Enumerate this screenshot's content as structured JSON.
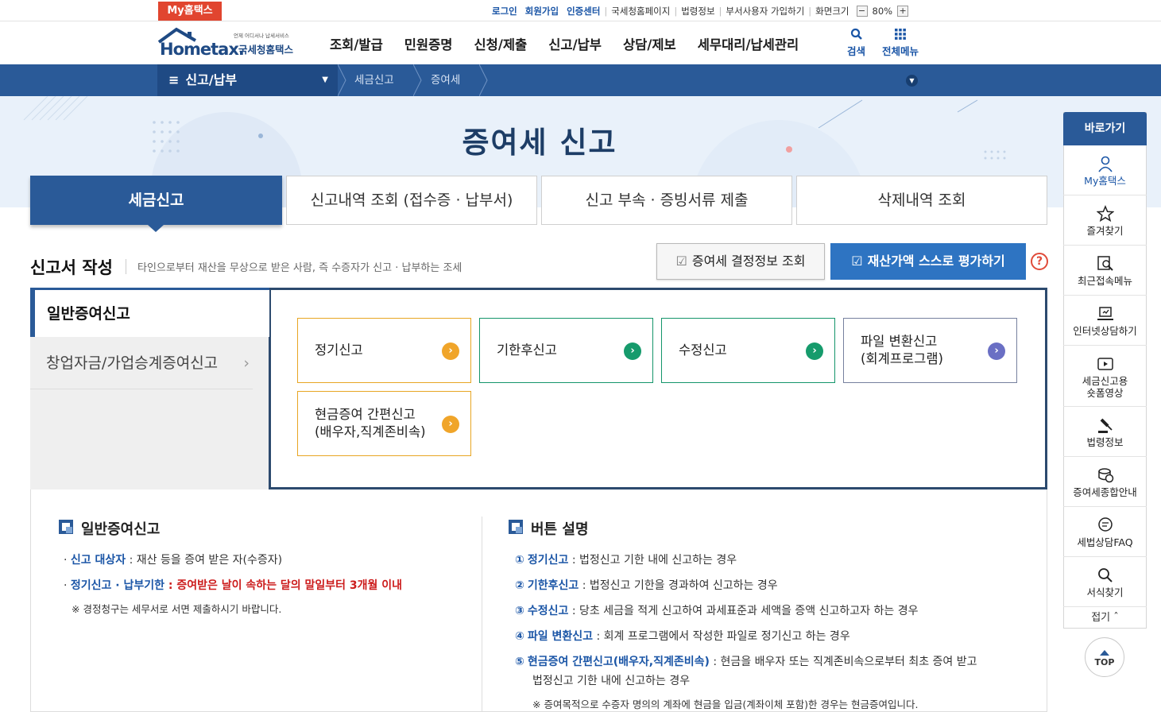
{
  "topbar": {
    "mytax_tab": "My홈택스",
    "login": "로그인",
    "signup": "회원가입",
    "cert_center": "인증센터",
    "nts_page": "국세청홈페이지",
    "law_info": "법령정보",
    "dept_signup": "부서사용자 가입하기",
    "zoom_label": "화면크기",
    "zoom_minus": "−",
    "zoom_value": "80%",
    "zoom_plus": "+"
  },
  "header": {
    "logo_small": "언제 어디서나 납세서비스",
    "logo_main": "Hometax.",
    "logo_sub": "국세청홈택스",
    "nav": [
      "조회/발급",
      "민원증명",
      "신청/제출",
      "신고/납부",
      "상담/제보",
      "세무대리/납세관리"
    ],
    "search_label": "검색",
    "allmenu_label": "전체메뉴"
  },
  "breadcrumb": {
    "main": "신고/납부",
    "items": [
      "세금신고",
      "증여세"
    ]
  },
  "hero": {
    "title": "증여세 신고"
  },
  "tabs": [
    {
      "label": "세금신고",
      "active": true
    },
    {
      "label": "신고내역 조회 (접수증 · 납부서)",
      "active": false
    },
    {
      "label": "신고 부속 · 증빙서류 제출",
      "active": false
    },
    {
      "label": "삭제내역 조회",
      "active": false
    }
  ],
  "section": {
    "title": "신고서 작성",
    "desc": "타인으로부터 재산을 무상으로 받은 사람, 즉 수증자가 신고 · 납부하는 조세",
    "btn_lookup": "증여세 결정정보 조회",
    "btn_eval": "재산가액 스스로 평가하기",
    "help": "?"
  },
  "side_menu": [
    {
      "label": "일반증여신고",
      "active": true
    },
    {
      "label": "창업자금/가업승계증여신고",
      "active": false
    }
  ],
  "options": [
    {
      "line1": "정기신고",
      "line2": "",
      "color": "#f0a52a"
    },
    {
      "line1": "기한후신고",
      "line2": "",
      "color": "#169b6c"
    },
    {
      "line1": "수정신고",
      "line2": "",
      "color": "#169b6c"
    },
    {
      "line1": "파일 변환신고",
      "line2": "(회계프로그램)",
      "color": "#6a6fc4"
    },
    {
      "line1": "현금증여 간편신고",
      "line2": "(배우자,직계존비속)",
      "color": "#f0a52a"
    }
  ],
  "info_left": {
    "heading": "일반증여신고",
    "item1_key": "신고 대상자",
    "item1_val": " : 재산 등을 증여 받은 자(수증자)",
    "item2_key": "정기신고 · 납부기한",
    "item2_val": " : 증여받은 날이 속하는 달의 말일부터 3개월 이내",
    "note": "※ 경정청구는 세무서로 서면 제출하시기 바랍니다."
  },
  "info_right": {
    "heading": "버튼 설명",
    "items": [
      {
        "num": "①",
        "key": "정기신고",
        "val": " : 법정신고 기한 내에 신고하는 경우"
      },
      {
        "num": "②",
        "key": "기한후신고",
        "val": " : 법정신고 기한을 경과하여 신고하는 경우"
      },
      {
        "num": "③",
        "key": "수정신고",
        "val": " : 당초 세금을 적게 신고하여 과세표준과 세액을 증액 신고하고자 하는 경우"
      },
      {
        "num": "④",
        "key": "파일 변환신고",
        "val": " : 회계 프로그램에서 작성한 파일로 정기신고 하는 경우"
      },
      {
        "num": "⑤",
        "key": "현금증여 간편신고(배우자,직계존비속)",
        "val": " : 현금을 배우자 또는 직계존비속으로부터 최초 증여 받고"
      }
    ],
    "item5_cont": "법정신고 기한 내에 신고하는 경우",
    "note": "※ 증여목적으로 수증자 명의의 계좌에 현금을 입금(계좌이체 포함)한 경우는 현금증여입니다."
  },
  "quick": {
    "head": "바로가기",
    "items": [
      "My홈택스",
      "즐겨찾기",
      "최근접속메뉴",
      "인터넷상담하기",
      "세금신고용",
      "숏폼영상",
      "법령정보",
      "증여세종합안내",
      "세법상담FAQ",
      "서식찾기"
    ],
    "fold": "접기",
    "top": "TOP"
  }
}
